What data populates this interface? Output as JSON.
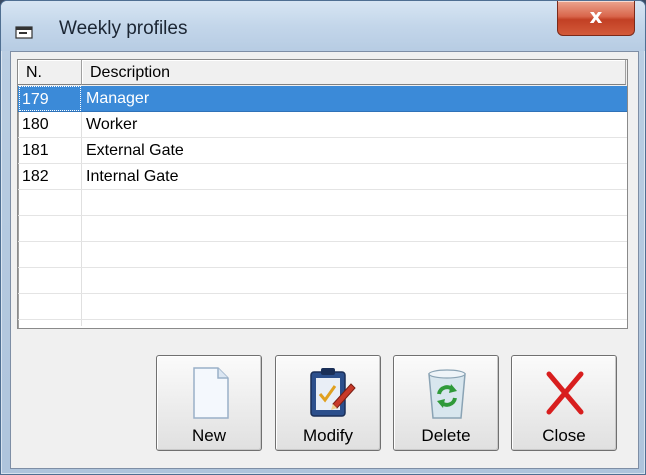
{
  "window": {
    "title": "Weekly profiles",
    "close_glyph": "x"
  },
  "list": {
    "columns": [
      "N.",
      "Description"
    ],
    "rows": [
      {
        "n": "179",
        "description": "Manager",
        "selected": true
      },
      {
        "n": "180",
        "description": "Worker",
        "selected": false
      },
      {
        "n": "181",
        "description": "External Gate",
        "selected": false
      },
      {
        "n": "182",
        "description": "Internal Gate",
        "selected": false
      }
    ],
    "selection_color": "#3b8ad8"
  },
  "buttons": {
    "new": {
      "label": "New",
      "icon": "document-icon"
    },
    "modify": {
      "label": "Modify",
      "icon": "edit-clipboard-icon"
    },
    "delete": {
      "label": "Delete",
      "icon": "recycle-bin-icon"
    },
    "close": {
      "label": "Close",
      "icon": "red-x-icon"
    }
  }
}
